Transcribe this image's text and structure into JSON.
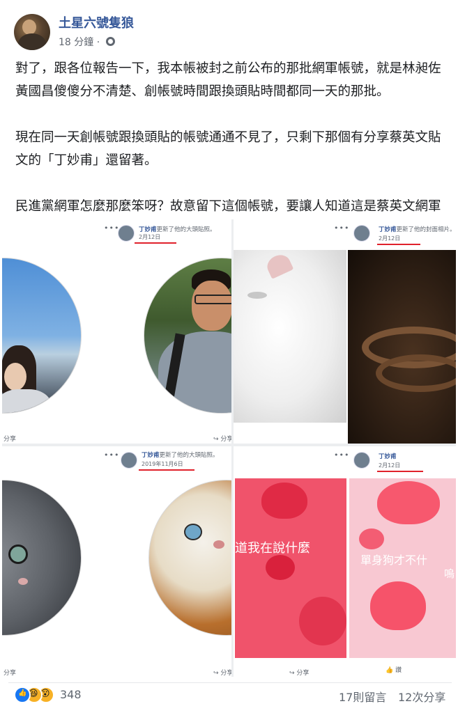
{
  "post": {
    "author": "土星六號隻狼",
    "time": "18 分鐘",
    "paragraphs": [
      "對了，跟各位報告一下，我本帳被封之前公布的那批網軍帳號，就是林昶佐黃國昌傻傻分不清楚、創帳號時間跟換頭貼時間都同一天的那批。",
      "現在同一天創帳號跟換頭貼的帳號通通不見了，只剩下那個有分享蔡英文貼文的「丁妙甫」還留著。",
      "民進黨網軍怎麼那麼笨呀？故意留下這個帳號，要讓人知道這是蔡英文網軍哦？真神奇。"
    ]
  },
  "screenshots": {
    "p1": {
      "name": "丁妙甫",
      "action": "更新了他的大頭貼照。",
      "date": "2月12日",
      "share": "分享",
      "share_left": "分享"
    },
    "p2": {
      "name": "丁妙甫",
      "action": "更新了他的封面相片。",
      "date": "2月12日"
    },
    "p3": {
      "name": "丁妙甫",
      "action": "更新了他的大頭貼照。",
      "date": "2019年11月6日",
      "share": "分享",
      "share_left": "分享"
    },
    "p4": {
      "name": "丁妙甫",
      "date": "2月12日",
      "text_left": "道我在說什麼",
      "text_right_1": "單身狗才不什",
      "text_right_2": "嗚",
      "share": "分享",
      "like": "讚"
    }
  },
  "footer": {
    "reactions": [
      "like",
      "haha",
      "wow"
    ],
    "reaction_count": "348",
    "comments": "17則留言",
    "shares": "12次分享"
  },
  "colors": {
    "link": "#365899",
    "meta": "#616770",
    "highlight": "#e0212b",
    "like": "#1877f2"
  }
}
